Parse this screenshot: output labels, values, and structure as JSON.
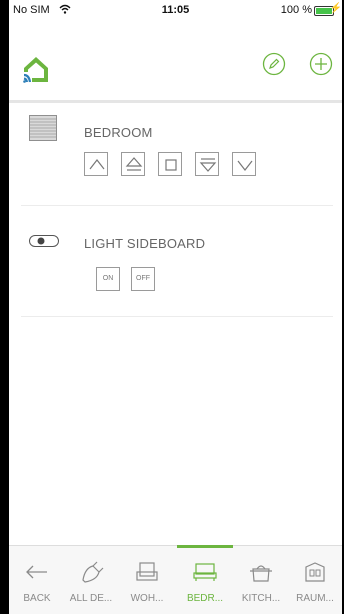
{
  "status_bar": {
    "carrier": "No SIM",
    "time": "11:05",
    "battery": "100 %"
  },
  "header": {
    "logo_icon": "home-wifi-logo-icon",
    "edit_icon": "pencil-icon",
    "add_icon": "plus-icon"
  },
  "devices": [
    {
      "name": "BEDROOM",
      "icon": "blinds-icon",
      "controls": [
        "up-icon",
        "up-step-icon",
        "stop-icon",
        "down-step-icon",
        "down-icon"
      ]
    },
    {
      "name": "LIGHT SIDEBOARD",
      "icon": "toggle-switch-icon",
      "controls": {
        "on": "ON",
        "off": "OFF"
      }
    }
  ],
  "tabs": [
    {
      "label": "BACK",
      "icon": "back-arrow-icon",
      "active": false
    },
    {
      "label": "ALL DE...",
      "icon": "plug-icon",
      "active": false
    },
    {
      "label": "WOH...",
      "icon": "armchair-icon",
      "active": false
    },
    {
      "label": "BEDR...",
      "icon": "bed-icon",
      "active": true
    },
    {
      "label": "KITCH...",
      "icon": "pot-icon",
      "active": false
    },
    {
      "label": "RAUM...",
      "icon": "room-icon",
      "active": false
    }
  ],
  "colors": {
    "accent": "#6cb53f",
    "logo_blue": "#2d7fb8",
    "text_muted": "#666666"
  }
}
